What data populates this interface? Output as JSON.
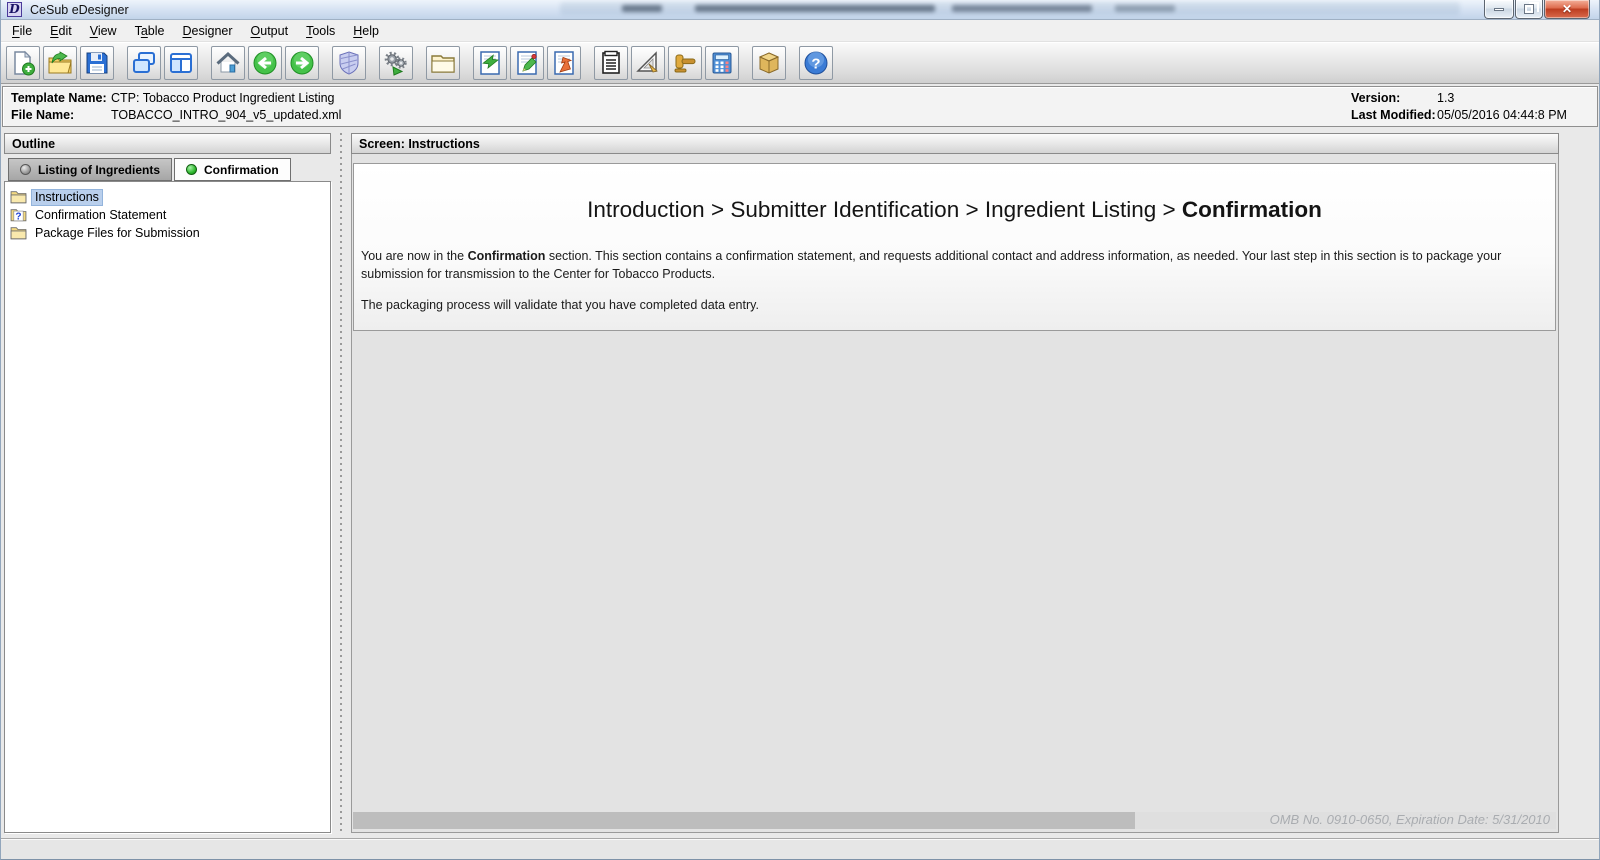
{
  "window": {
    "title": "CeSub eDesigner",
    "icon_letter": "D",
    "controls": [
      "minimize",
      "restore",
      "close"
    ]
  },
  "menu": {
    "items": [
      {
        "pre": "",
        "key": "F",
        "post": "ile"
      },
      {
        "pre": "",
        "key": "E",
        "post": "dit"
      },
      {
        "pre": "",
        "key": "V",
        "post": "iew"
      },
      {
        "pre": "T",
        "key": "a",
        "post": "ble"
      },
      {
        "pre": "",
        "key": "D",
        "post": "esigner"
      },
      {
        "pre": "",
        "key": "O",
        "post": "utput"
      },
      {
        "pre": "",
        "key": "T",
        "post": "ools"
      },
      {
        "pre": "",
        "key": "H",
        "post": "elp"
      }
    ]
  },
  "toolbar": {
    "groups": [
      [
        "new-document",
        "open-file",
        "save"
      ],
      [
        "cascade-windows",
        "split-view"
      ],
      [
        "home",
        "navigate-back",
        "navigate-forward"
      ],
      [
        "validate-shield"
      ],
      [
        "run-process"
      ],
      [
        "open-folder"
      ],
      [
        "import-document",
        "edit-document",
        "export-document"
      ],
      [
        "report-form",
        "design-tools",
        "gavel",
        "calculator"
      ],
      [
        "package-box"
      ],
      [
        "help"
      ]
    ]
  },
  "file_info": {
    "template_name_label": "Template Name:",
    "template_name": "CTP: Tobacco Product Ingredient Listing",
    "file_name_label": "File Name:",
    "file_name": "TOBACCO_INTRO_904_v5_updated.xml",
    "version_label": "Version:",
    "version": "1.3",
    "last_modified_label": "Last Modified:",
    "last_modified": "05/05/2016 04:44:8 PM"
  },
  "outline": {
    "header": "Outline",
    "tabs": [
      {
        "label": "Listing of Ingredients",
        "status_color": "#9c9c9c",
        "active": false
      },
      {
        "label": "Confirmation",
        "status_color": "#2eb82e",
        "active": true
      }
    ],
    "tree": [
      {
        "icon": "folder-icon",
        "label": "Instructions",
        "selected": true
      },
      {
        "icon": "folder-question-icon",
        "label": "Confirmation Statement",
        "selected": false
      },
      {
        "icon": "folder-icon",
        "label": "Package Files for Submission",
        "selected": false
      }
    ]
  },
  "screen": {
    "header": "Screen: Instructions",
    "breadcrumb": {
      "path": "Introduction > Submitter Identification > Ingredient Listing > ",
      "current": "Confirmation"
    },
    "paragraph1": {
      "pre": "You are now in the ",
      "bold": "Confirmation",
      "post": " section. This section contains a confirmation statement, and requests additional contact and address information, as needed. Your last step in this section is to package your submission for transmission to the Center for Tobacco Products."
    },
    "paragraph2": "The packaging process will validate that you have completed data entry.",
    "footer_note": "OMB No. 0910-0650, Expiration Date: 5/31/2010"
  },
  "colors": {
    "titlebar": "#d4e1f2",
    "selection": "#b9cfec",
    "status_green": "#2eb82e",
    "status_gray": "#9c9c9c",
    "close_button": "#bc3c20"
  }
}
